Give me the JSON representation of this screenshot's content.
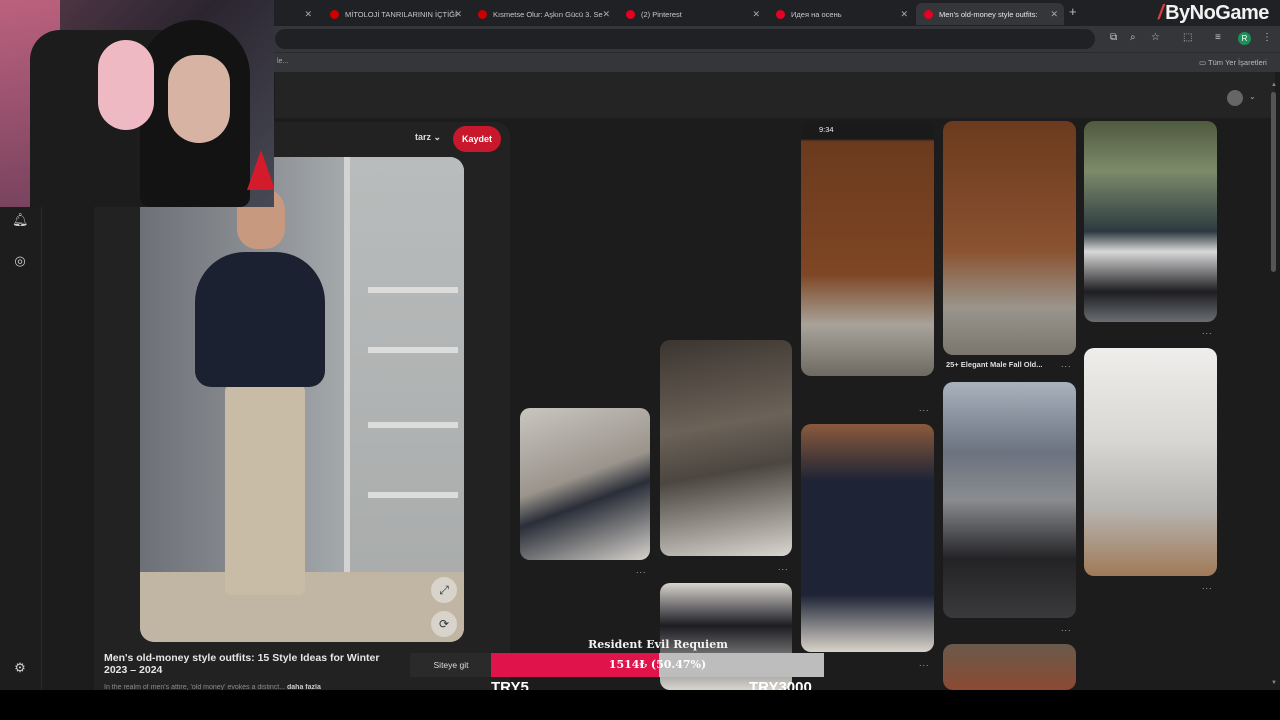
{
  "browser": {
    "tabs": [
      {
        "label": "",
        "favicon_color": "#cc0000"
      },
      {
        "label": "MİTOLOJİ TANRILARININ İÇTİĞİ",
        "favicon_color": "#cc0000"
      },
      {
        "label": "Kısmetse Olur: Aşkın Gücü 3. Se",
        "favicon_color": "#cc0000"
      },
      {
        "label": "(2) Pinterest",
        "favicon_color": "#e60023"
      },
      {
        "label": "Идея на осень",
        "favicon_color": "#e60023"
      },
      {
        "label": "Men's old-money style outfits:",
        "favicon_color": "#e60023"
      }
    ],
    "active_tab_index": 5,
    "new_tab_icon": "plus-icon",
    "profile_initial": "R",
    "bookmarks": {
      "left_fragment": "le...",
      "all_bookmarks_label": "Tüm Yer İşaretleri"
    }
  },
  "brand": {
    "name": "ByNoGame"
  },
  "pinterest": {
    "board_select": "tarz",
    "save_label": "Kaydet",
    "pin_title": "Men's old-money style outfits: 15 Style Ideas for Winter 2023 – 2024",
    "pin_description": "In the realm of men's attire, 'old money' evokes a distinct...",
    "pin_description_more": "daha fazla",
    "grid_captions": {
      "elegant_male": "25+ Elegant Male Fall Old...",
      "phone_time": "9:34"
    },
    "grid_dots": "...",
    "rail_icons": [
      "bell-icon",
      "message-icon",
      "settings-icon"
    ]
  },
  "donation": {
    "title": "Resident Evil Requiem",
    "site_button": "Siteye git",
    "progress_text": "1514₺ (50.47%)",
    "progress_fraction": 0.5047,
    "goal_min": "TRY5",
    "goal_max": "TRY3000",
    "colors": {
      "fill": "#e0134a",
      "track": "#bdbdbd"
    }
  }
}
